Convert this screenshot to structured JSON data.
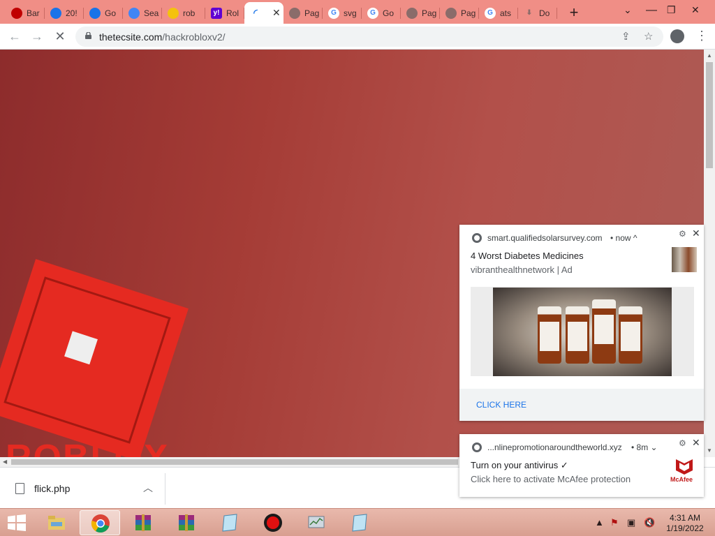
{
  "browser": {
    "tabs": [
      {
        "label": "Bar",
        "icon": "record-icon",
        "color": "#c00000"
      },
      {
        "label": "20!",
        "icon": "drive-icon",
        "color": "#1a73e8"
      },
      {
        "label": "Go",
        "icon": "drive-icon",
        "color": "#1a73e8"
      },
      {
        "label": "Sea",
        "icon": "search-icon",
        "color": "#4285f4"
      },
      {
        "label": "rob",
        "icon": "norton-icon",
        "color": "#f4c20d"
      },
      {
        "label": "Rol",
        "icon": "yahoo-icon",
        "color": "#6001d2"
      },
      {
        "label": "",
        "icon": "loading-icon",
        "color": "#1a73e8",
        "active": true
      },
      {
        "label": "Pag",
        "icon": "globe-icon",
        "color": "#8a6c6a"
      },
      {
        "label": "svg",
        "icon": "google-icon",
        "color": "#4285f4"
      },
      {
        "label": "Go",
        "icon": "google-icon",
        "color": "#4285f4"
      },
      {
        "label": "Pag",
        "icon": "globe-icon",
        "color": "#8a6c6a"
      },
      {
        "label": "Pag",
        "icon": "globe-icon",
        "color": "#8a6c6a"
      },
      {
        "label": "ats",
        "icon": "google-icon",
        "color": "#4285f4"
      },
      {
        "label": "Do",
        "icon": "download-icon",
        "color": "#8a6c6a"
      }
    ],
    "new_tab": "+",
    "window": {
      "dropdown": "⌄",
      "restore": "❐",
      "close": "✕"
    },
    "url_host": "thetecsite.com",
    "url_path": "/hackrobloxv2/"
  },
  "page": {
    "logo_text": "ROBLOX"
  },
  "downloads": {
    "file_name": "flick.php"
  },
  "notifications": [
    {
      "origin": "smart.qualifiedsolarsurvey.com",
      "time": "• now ^",
      "title": "4 Worst Diabetes Medicines",
      "body": "vibranthealthnetwork | Ad",
      "action": "CLICK HERE"
    },
    {
      "origin": "...nlinepromotionaroundtheworld.xyz",
      "time": "• 8m ⌄",
      "title": "Turn on your antivirus ✓",
      "body": "Click here to activate McAfee protection",
      "brand": "McAfee"
    }
  ],
  "taskbar": {
    "time": "4:31 AM",
    "date": "1/19/2022"
  },
  "colors": {
    "tabstrip": "#f08e86",
    "roblox_red": "#e52a21",
    "taskbar": "#e9b9ac",
    "link_blue": "#1a73e8"
  }
}
